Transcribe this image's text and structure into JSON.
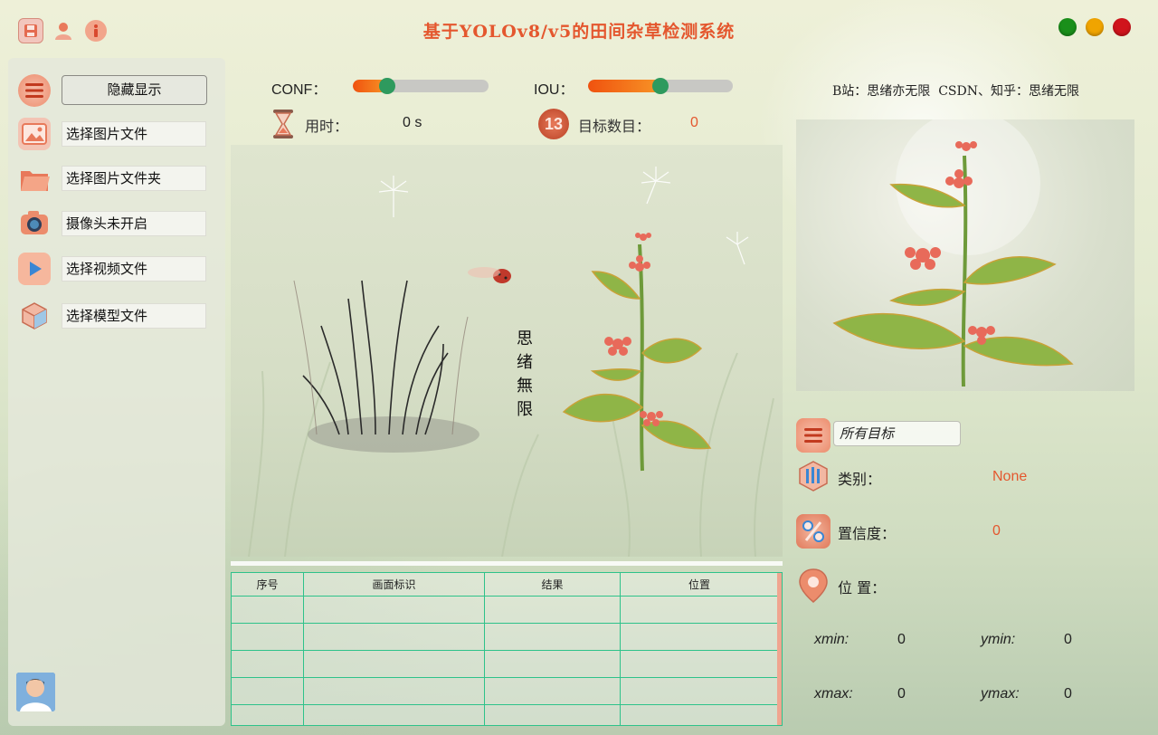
{
  "window": {
    "title": "基于YOLOv8/v5的田间杂草检测系统",
    "icons": [
      "save-icon",
      "user-icon",
      "info-icon"
    ],
    "controls": [
      "maximize-button",
      "minimize-button",
      "close-button"
    ],
    "control_colors": {
      "green": "#1a8f1a",
      "orange": "#f0a400",
      "red": "#d0141c"
    }
  },
  "sidebar": {
    "hide_label": "隐藏显示",
    "items": [
      {
        "label": "选择图片文件",
        "icon": "image-icon"
      },
      {
        "label": "选择图片文件夹",
        "icon": "folder-icon"
      },
      {
        "label": "摄像头未开启",
        "icon": "camera-icon"
      },
      {
        "label": "选择视频文件",
        "icon": "play-icon"
      },
      {
        "label": "选择模型文件",
        "icon": "cube-icon"
      }
    ]
  },
  "controls": {
    "conf_label": "CONF：",
    "conf_value": 0.25,
    "iou_label": "IOU：",
    "iou_value": 0.5,
    "time_label": "用时：",
    "time_value": "0 s",
    "count_label": "目标数目：",
    "count_value": "0",
    "count_badge": "13"
  },
  "main_image": {
    "caption": [
      "思",
      "绪",
      "無",
      "限"
    ]
  },
  "credits": "B站：思绪亦无限  CSDN、知乎：思绪无限",
  "table": {
    "headers": [
      "序号",
      "画面标识",
      "结果",
      "位置"
    ],
    "rows": 5
  },
  "details": {
    "target_select": "所有目标",
    "class_label": "类别：",
    "class_value": "None",
    "conf_label": "置信度：",
    "conf_value": "0",
    "pos_label": "位 置：",
    "xmin_label": "xmin:",
    "xmin_value": "0",
    "ymin_label": "ymin:",
    "ymin_value": "0",
    "xmax_label": "xmax:",
    "xmax_value": "0",
    "ymax_label": "ymax:",
    "ymax_value": "0"
  },
  "colors": {
    "accent": "#e4572e",
    "slider_fill": "#f0520f",
    "slider_handle": "#2e9a5e",
    "table_border": "#2ec28a"
  }
}
